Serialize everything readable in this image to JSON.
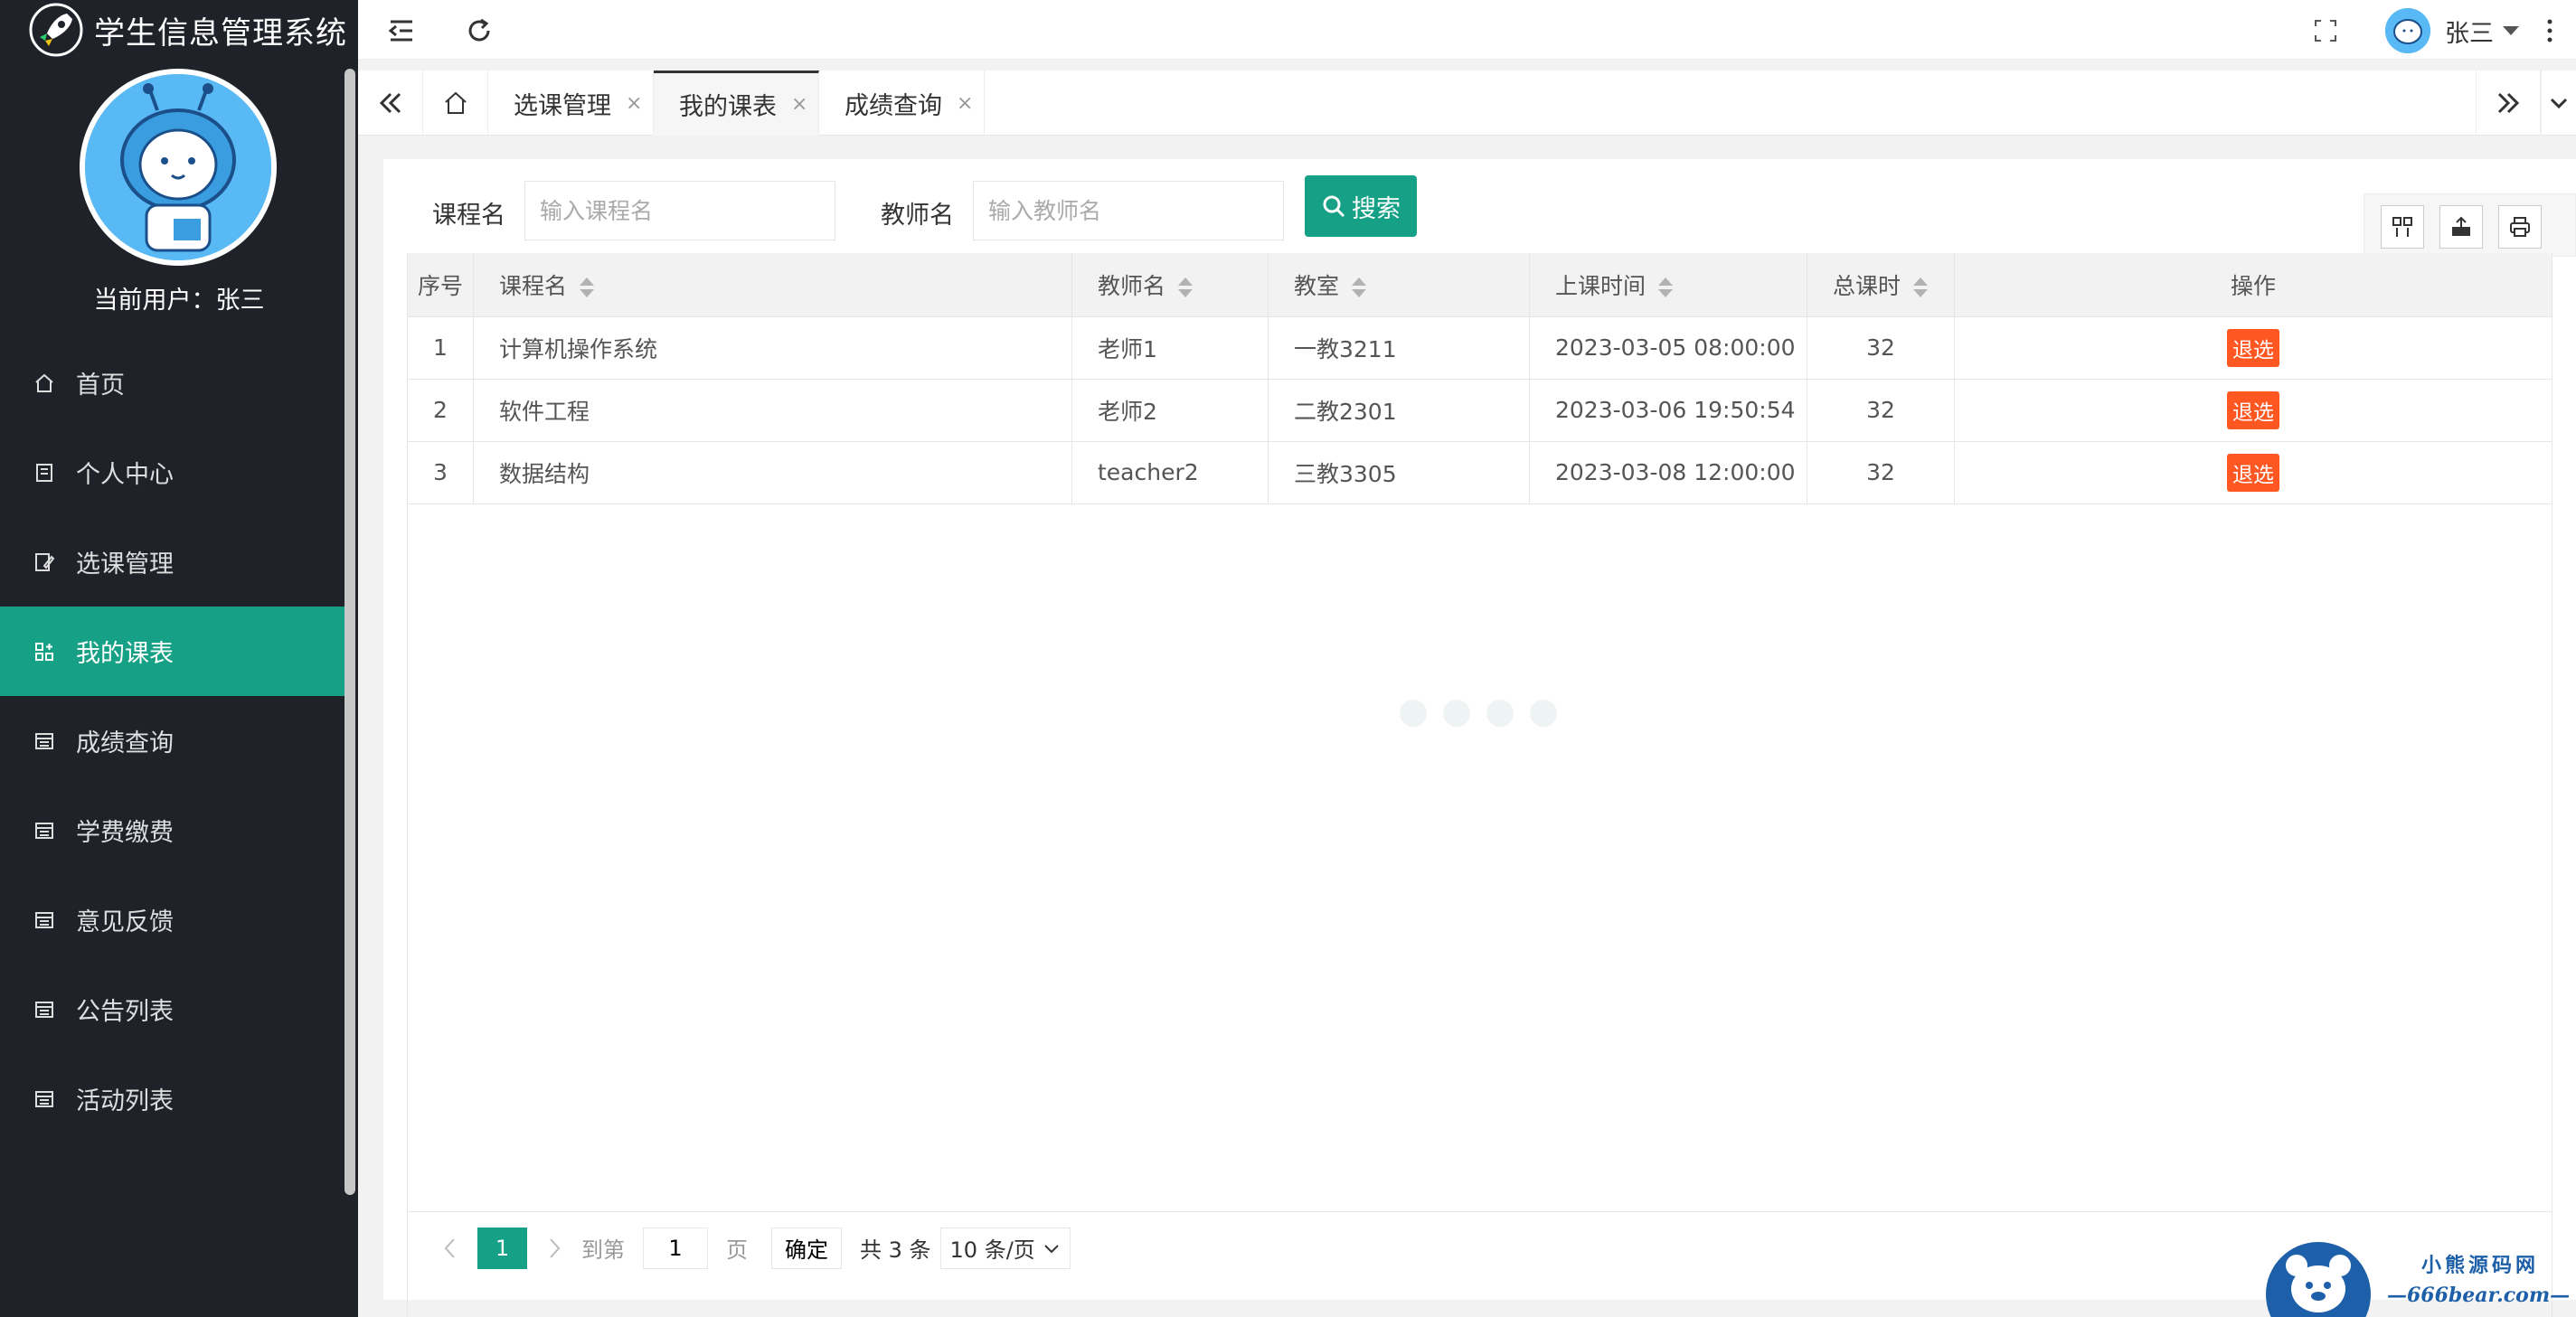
{
  "app": {
    "title": "学生信息管理系统",
    "current_user_label": "当前用户：张三"
  },
  "sidebar": {
    "items": [
      {
        "label": "首页",
        "icon": "home-icon",
        "active": false
      },
      {
        "label": "个人中心",
        "icon": "doc-icon",
        "active": false
      },
      {
        "label": "选课管理",
        "icon": "edit-icon",
        "active": false
      },
      {
        "label": "我的课表",
        "icon": "grid-add-icon",
        "active": true
      },
      {
        "label": "成绩查询",
        "icon": "list-icon",
        "active": false
      },
      {
        "label": "学费缴费",
        "icon": "list-icon",
        "active": false
      },
      {
        "label": "意见反馈",
        "icon": "list-icon",
        "active": false
      },
      {
        "label": "公告列表",
        "icon": "list-icon",
        "active": false
      },
      {
        "label": "活动列表",
        "icon": "list-icon",
        "active": false
      }
    ]
  },
  "header": {
    "username": "张三"
  },
  "tabs": [
    {
      "label": "选课管理",
      "active": false,
      "closable": "×"
    },
    {
      "label": "我的课表",
      "active": true,
      "closable": "×"
    },
    {
      "label": "成绩查询",
      "active": false,
      "closable": "×"
    }
  ],
  "search": {
    "course_label": "课程名",
    "course_placeholder": "输入课程名",
    "teacher_label": "教师名",
    "teacher_placeholder": "输入教师名",
    "button": "搜索"
  },
  "table": {
    "headers": {
      "index": "序号",
      "course": "课程名",
      "teacher": "教师名",
      "room": "教室",
      "time": "上课时间",
      "hours": "总课时",
      "action": "操作"
    },
    "rows": [
      {
        "index": "1",
        "course": "计算机操作系统",
        "teacher": "老师1",
        "room": "一教3211",
        "time": "2023-03-05 08:00:00",
        "hours": "32",
        "action": "退选"
      },
      {
        "index": "2",
        "course": "软件工程",
        "teacher": "老师2",
        "room": "二教2301",
        "time": "2023-03-06 19:50:54",
        "hours": "32",
        "action": "退选"
      },
      {
        "index": "3",
        "course": "数据结构",
        "teacher": "teacher2",
        "room": "三教3305",
        "time": "2023-03-08 12:00:00",
        "hours": "32",
        "action": "退选"
      }
    ]
  },
  "pager": {
    "current": "1",
    "goto_label": "到第",
    "goto_value": "1",
    "page_label": "页",
    "ok": "确定",
    "total": "共 3 条",
    "page_size": "10 条/页"
  },
  "watermark": {
    "line1": "小熊源码网",
    "line2": "—666bear.com—"
  },
  "colors": {
    "accent": "#16a085",
    "sidebar": "#20222a",
    "danger": "#ff5722"
  }
}
